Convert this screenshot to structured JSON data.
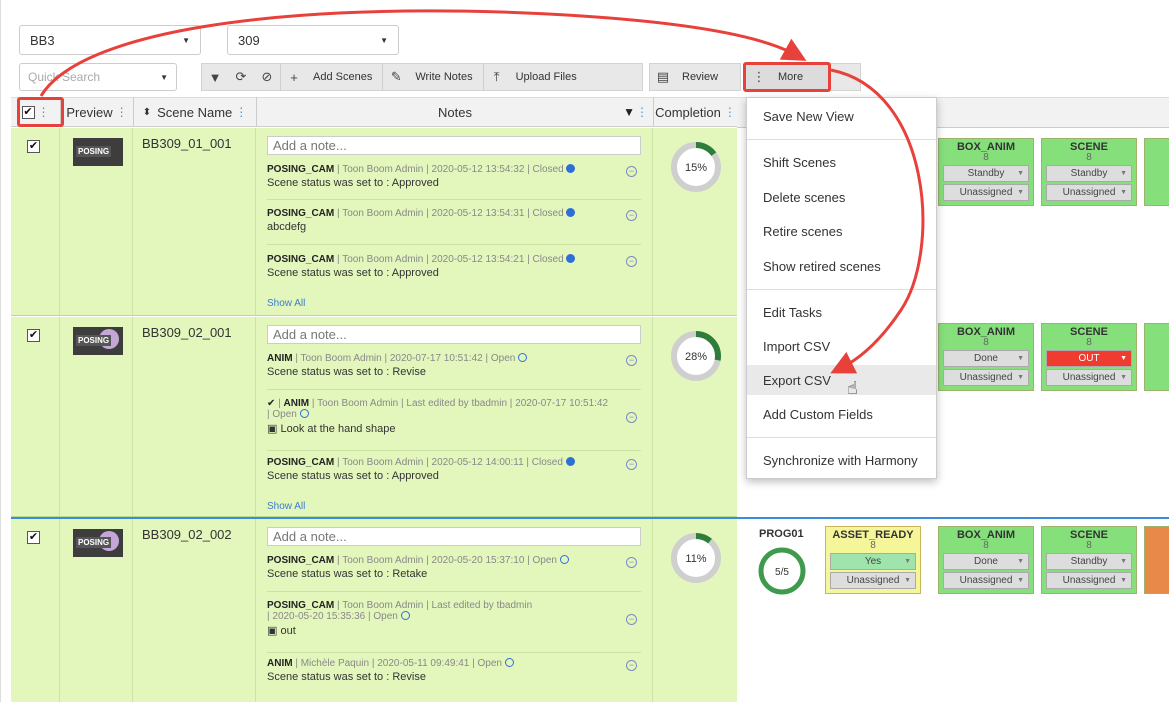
{
  "filters": {
    "project_value": "BB3",
    "episode_value": "309",
    "quick_search_placeholder": "Quick Search"
  },
  "toolbar": {
    "add_scenes": "Add Scenes",
    "write_notes": "Write Notes",
    "upload_files": "Upload Files",
    "review": "Review",
    "more": "More"
  },
  "columns": {
    "preview": "Preview",
    "scene_name": "Scene Name",
    "notes": "Notes",
    "completion": "Completion"
  },
  "add_note_placeholder": "Add a note...",
  "show_all": "Show All",
  "rows": [
    {
      "thumb_tag": "POSING",
      "scene": "BB309_01_001",
      "completion": "15%",
      "completion_value": 15,
      "notes": [
        {
          "type": "POSING_CAM",
          "meta": " | Toon Boom Admin | 2020-05-12 13:54:32 | Closed",
          "msg": "Scene status was set to : Approved"
        },
        {
          "type": "POSING_CAM",
          "meta": " | Toon Boom Admin | 2020-05-12 13:54:31 | Closed",
          "msg": "abcdefg"
        },
        {
          "type": "POSING_CAM",
          "meta": " | Toon Boom Admin | 2020-05-12 13:54:21 | Closed",
          "msg": "Scene status was set to : Approved"
        }
      ]
    },
    {
      "thumb_tag": "POSING",
      "scene": "BB309_02_001",
      "completion": "28%",
      "completion_value": 28,
      "notes": [
        {
          "type": "ANIM",
          "meta": " | Toon Boom Admin | 2020-07-17 10:51:42 | Open",
          "msg": "Scene status was set to : Revise"
        },
        {
          "type": "ANIM",
          "meta": " | Toon Boom Admin | Last edited by tbadmin | 2020-07-17 10:51:42",
          "meta2": "| Open",
          "msg": "Look at the hand shape"
        },
        {
          "type": "POSING_CAM",
          "meta": " | Toon Boom Admin | 2020-05-12 14:00:11 | Closed",
          "msg": "Scene status was set to : Approved"
        }
      ]
    },
    {
      "thumb_tag": "POSING",
      "scene": "BB309_02_002",
      "completion": "11%",
      "completion_value": 11,
      "notes": [
        {
          "type": "POSING_CAM",
          "meta": " | Toon Boom Admin | 2020-05-20 15:37:10 | Open",
          "msg": "Scene status was set to : Retake"
        },
        {
          "type": "POSING_CAM",
          "meta": " | Toon Boom Admin | Last edited by tbadmin",
          "meta2": "| 2020-05-20 15:35:36 | Open",
          "msg": "out"
        },
        {
          "type": "ANIM",
          "meta": " | Michèle Paquin | 2020-05-11 09:49:41 | Open",
          "msg": "Scene status was set to : Revise"
        }
      ]
    }
  ],
  "more_menu": [
    "Save New View",
    "Shift Scenes",
    "Delete scenes",
    "Retire scenes",
    "Show retired scenes",
    "Edit Tasks",
    "Import CSV",
    "Export CSV",
    "Add Custom Fields",
    "Synchronize with Harmony"
  ],
  "tasks": {
    "row1": [
      {
        "name": "BOX_ANIM",
        "count": "8",
        "status": "Standby",
        "assignee": "Unassigned"
      },
      {
        "name": "SCENE",
        "count": "8",
        "status": "Standby",
        "assignee": "Unassigned"
      }
    ],
    "row2": [
      {
        "name": "BOX_ANIM",
        "count": "8",
        "status": "Done",
        "assignee": "Unassigned"
      },
      {
        "name": "SCENE",
        "count": "8",
        "status": "OUT",
        "assignee": "Unassigned"
      }
    ],
    "row3": [
      {
        "name": "ASSET_READY",
        "count": "8",
        "status": "Yes",
        "assignee": "Unassigned"
      },
      {
        "name": "BOX_ANIM",
        "count": "8",
        "status": "Done",
        "assignee": "Unassigned"
      },
      {
        "name": "SCENE",
        "count": "8",
        "status": "Standby",
        "assignee": "Unassigned"
      }
    ],
    "prog_label": "PROG01",
    "prog_value": "5/5"
  },
  "colors": {
    "row_bg": "#e3f7bd",
    "task_green": "#85e07c",
    "task_yellow": "#f5f59a",
    "out_red": "#f03c2e",
    "annotation_red": "#e8413c",
    "link_blue": "#3a7dd0"
  }
}
